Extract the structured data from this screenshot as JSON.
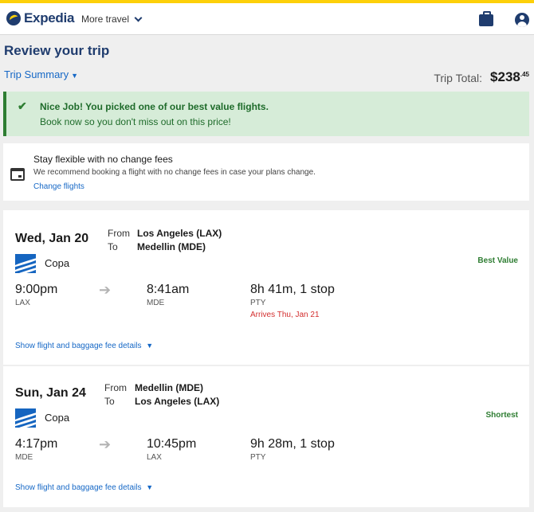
{
  "header": {
    "logo_text": "Expedia",
    "more_travel_label": "More travel"
  },
  "page": {
    "title": "Review your trip",
    "trip_summary_label": "Trip Summary",
    "trip_total_label": "Trip Total:",
    "trip_total_value": "$238",
    "trip_total_cents": ".45"
  },
  "banner": {
    "title": "Nice Job! You picked one of our best value flights.",
    "subtitle": "Book now so you don't miss out on this price!"
  },
  "flex": {
    "title": "Stay flexible with no change fees",
    "subtitle": "We recommend booking a flight with no change fees in case your plans change.",
    "link": "Change flights"
  },
  "flights": [
    {
      "date": "Wed, Jan 20",
      "from_label": "From",
      "to_label": "To",
      "from_city": "Los Angeles (LAX)",
      "to_city": "Medellin (MDE)",
      "airline": "Copa",
      "badge": "Best Value",
      "depart_time": "9:00pm",
      "depart_code": "LAX",
      "arrive_time": "8:41am",
      "arrive_code": "MDE",
      "duration": "8h 41m, 1 stop",
      "stop_code": "PTY",
      "arrives_note": "Arrives Thu, Jan 21",
      "details_link": "Show flight and baggage fee details"
    },
    {
      "date": "Sun, Jan 24",
      "from_label": "From",
      "to_label": "To",
      "from_city": "Medellin (MDE)",
      "to_city": "Los Angeles (LAX)",
      "airline": "Copa",
      "badge": "Shortest",
      "depart_time": "4:17pm",
      "depart_code": "MDE",
      "arrive_time": "10:45pm",
      "arrive_code": "LAX",
      "duration": "9h 28m, 1 stop",
      "stop_code": "PTY",
      "details_link": "Show flight and baggage fee details"
    }
  ],
  "icons": {
    "logo": "expedia-logo-icon",
    "more_travel_chevron": "chevron-down-icon",
    "trips": "suitcase-icon",
    "account": "user-icon",
    "success": "check-icon",
    "flex": "calendar-icon",
    "airline": "copa-airline-icon",
    "arrow": "arrow-right-icon",
    "expand": "double-chevron-down-icon"
  },
  "colors": {
    "brand": "#1f3c6e",
    "accent_yellow": "#fdd00a",
    "link": "#1668c6",
    "success": "#2e7d32",
    "success_bg": "#d6ecd8",
    "alert": "#d32f2f"
  }
}
